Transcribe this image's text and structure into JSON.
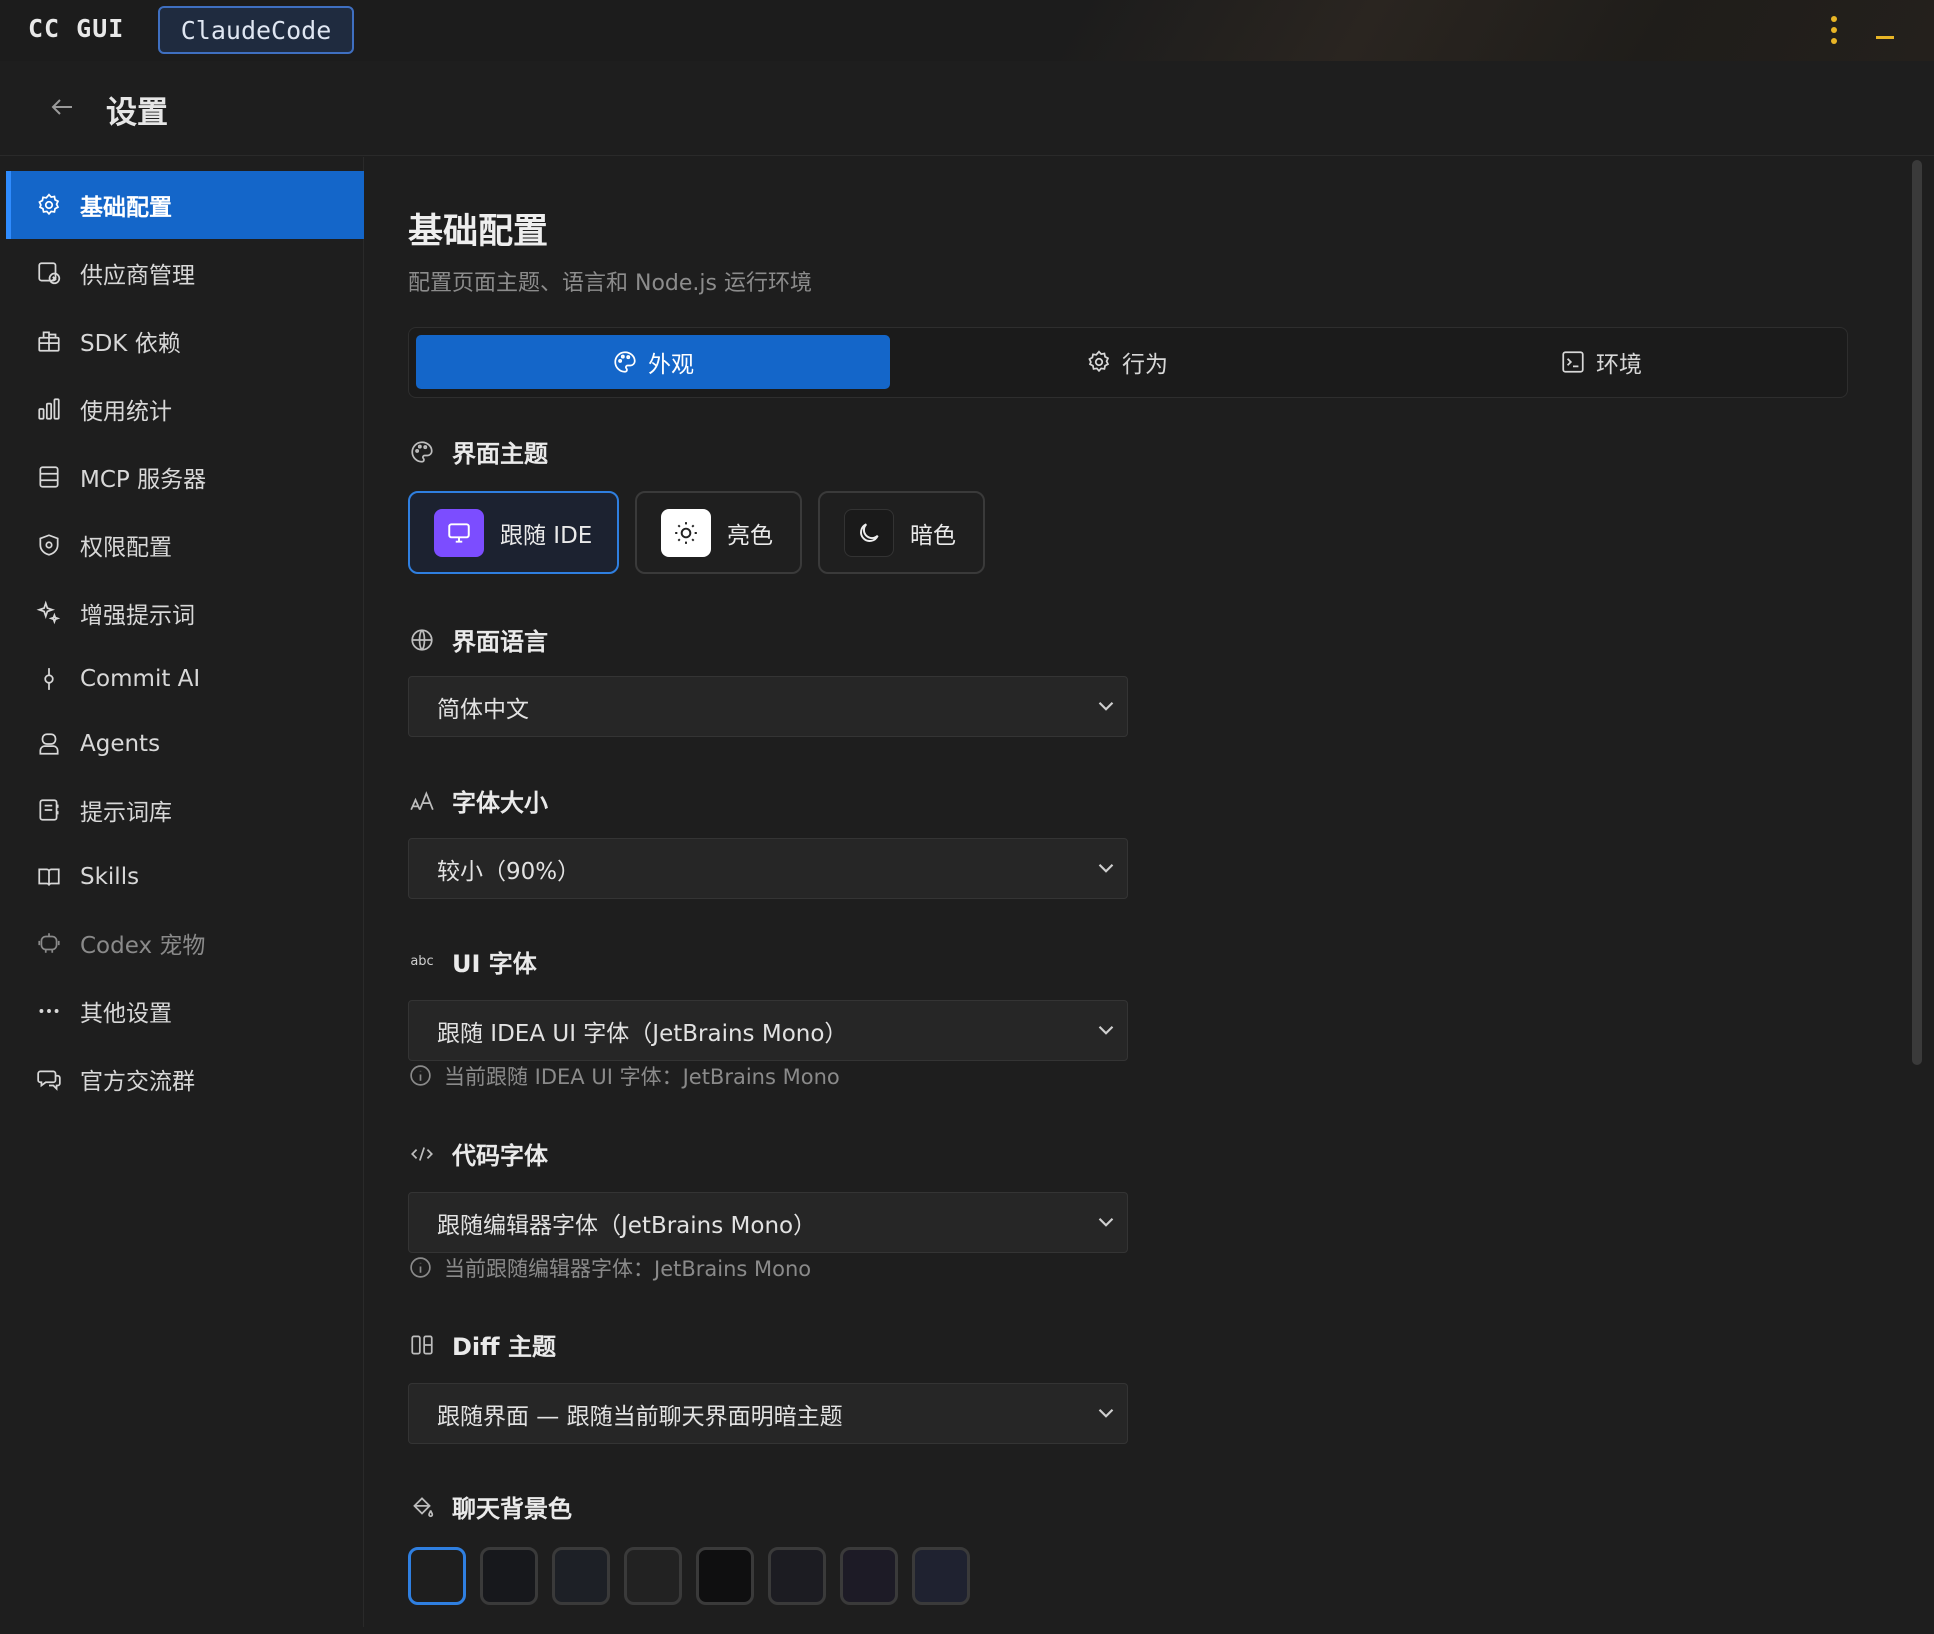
{
  "topbar": {
    "app_title": "CC GUI",
    "session_tab": "ClaudeCode"
  },
  "header": {
    "title": "设置"
  },
  "sidebar": {
    "items": [
      {
        "label": "基础配置",
        "icon": "gear-icon",
        "active": true
      },
      {
        "label": "供应商管理",
        "icon": "provider-icon"
      },
      {
        "label": "SDK 依赖",
        "icon": "package-icon"
      },
      {
        "label": "使用统计",
        "icon": "bar-chart-icon"
      },
      {
        "label": "MCP 服务器",
        "icon": "server-icon"
      },
      {
        "label": "权限配置",
        "icon": "shield-icon"
      },
      {
        "label": "增强提示词",
        "icon": "sparkle-icon"
      },
      {
        "label": "Commit AI",
        "icon": "git-commit-icon"
      },
      {
        "label": "Agents",
        "icon": "agent-icon"
      },
      {
        "label": "提示词库",
        "icon": "notebook-icon"
      },
      {
        "label": "Skills",
        "icon": "book-open-icon"
      },
      {
        "label": "Codex 宠物",
        "icon": "pet-icon",
        "dim": true
      },
      {
        "label": "其他设置",
        "icon": "ellipsis-icon"
      },
      {
        "label": "官方交流群",
        "icon": "chat-icon"
      }
    ]
  },
  "main": {
    "title": "基础配置",
    "subtitle": "配置页面主题、语言和 Node.js 运行环境",
    "tabs": [
      {
        "label": "外观",
        "icon": "palette-icon",
        "active": true
      },
      {
        "label": "行为",
        "icon": "gear-icon"
      },
      {
        "label": "环境",
        "icon": "terminal-icon"
      }
    ],
    "theme": {
      "heading": "界面主题",
      "options": [
        {
          "label": "跟随 IDE",
          "icon": "monitor-icon",
          "active": true
        },
        {
          "label": "亮色",
          "icon": "sun-icon"
        },
        {
          "label": "暗色",
          "icon": "moon-icon"
        }
      ]
    },
    "language": {
      "heading": "界面语言",
      "value": "简体中文"
    },
    "font_size": {
      "heading": "字体大小",
      "value": "较小（90%）"
    },
    "ui_font": {
      "heading": "UI 字体",
      "icon_text": "abc",
      "value": "跟随 IDEA UI 字体（JetBrains Mono）",
      "hint": "当前跟随 IDEA UI 字体：JetBrains Mono"
    },
    "code_font": {
      "heading": "代码字体",
      "value": "跟随编辑器字体（JetBrains Mono）",
      "hint": "当前跟随编辑器字体：JetBrains Mono"
    },
    "diff_theme": {
      "heading": "Diff 主题",
      "value": "跟随界面 — 跟随当前聊天界面明暗主题"
    },
    "chat_bg": {
      "heading": "聊天背景色",
      "swatches": [
        "#1e1e1e",
        "#17181c",
        "#1d2026",
        "#222222",
        "#0f0f10",
        "#1c1c22",
        "#1d1b26",
        "#1f2230"
      ]
    }
  },
  "colors": {
    "accent": "#1466c9",
    "theme_active_border": "#2f7fe0",
    "ide_icon_bg": "#7c4dff",
    "warning_yellow": "#e8b526"
  }
}
